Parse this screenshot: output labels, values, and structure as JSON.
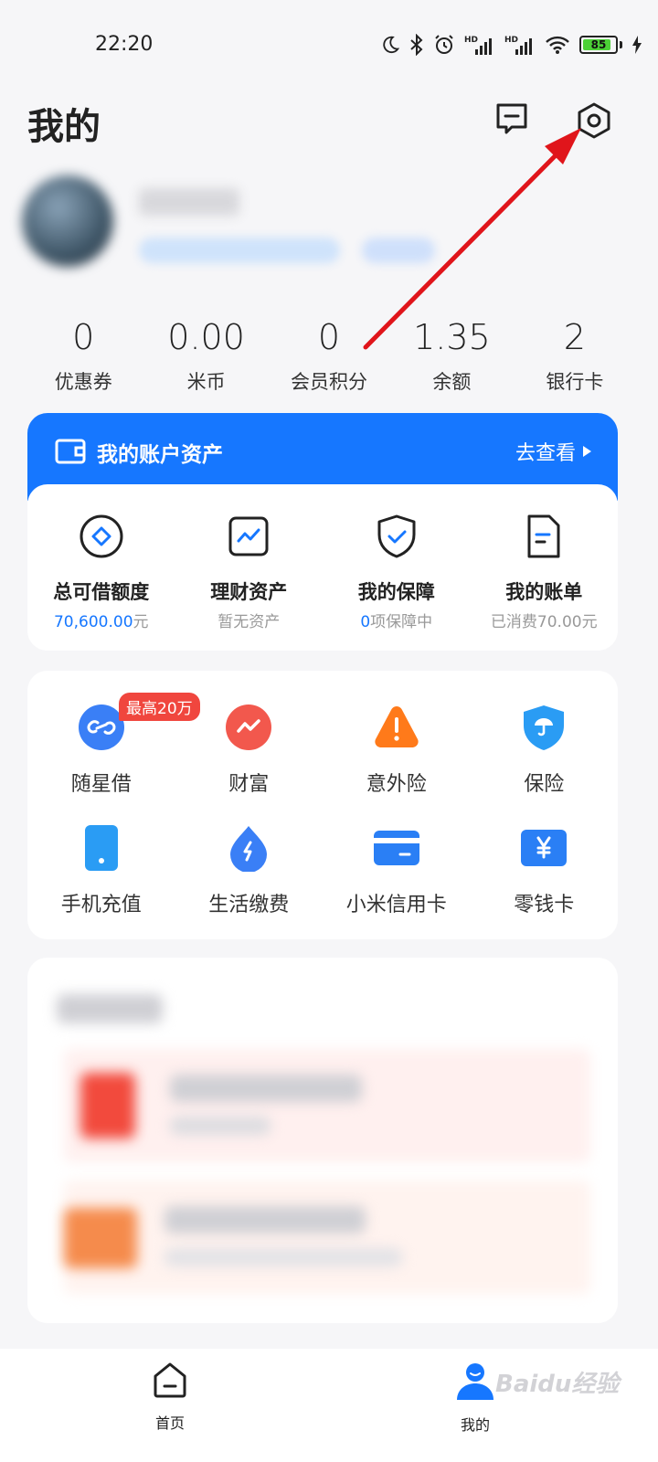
{
  "status_bar": {
    "time": "22:20",
    "battery": "85",
    "icons": [
      "moon-icon",
      "bluetooth-icon",
      "alarm-icon",
      "hd-signal-icon",
      "hd-signal-icon",
      "wifi-icon",
      "battery-icon",
      "charging-icon"
    ]
  },
  "header": {
    "title": "我的"
  },
  "stats": [
    {
      "value": "0",
      "label": "优惠券"
    },
    {
      "value": "0.00",
      "label": "米币"
    },
    {
      "value": "0",
      "label": "会员积分"
    },
    {
      "value": "1.35",
      "label": "余额"
    },
    {
      "value": "2",
      "label": "银行卡"
    }
  ],
  "assets": {
    "title": "我的账户资产",
    "link": "去查看",
    "items": [
      {
        "title": "总可借额度",
        "sub_value": "70,600.00",
        "sub_suffix": "元",
        "icon": "credit-diamond-icon"
      },
      {
        "title": "理财资产",
        "sub": "暂无资产",
        "icon": "wealth-chart-icon"
      },
      {
        "title": "我的保障",
        "sub_value": "0",
        "sub_suffix": "项保障中",
        "icon": "shield-check-icon"
      },
      {
        "title": "我的账单",
        "sub": "已消费70.00元",
        "icon": "bill-icon"
      }
    ]
  },
  "services": {
    "items": [
      {
        "label": "随星借",
        "badge": "最高20万",
        "icon": "link-loan-icon",
        "color": "#3a7ff6"
      },
      {
        "label": "财富",
        "icon": "wealth-trend-icon",
        "color": "#f2584d"
      },
      {
        "label": "意外险",
        "icon": "warning-icon",
        "color": "#ff7a1a"
      },
      {
        "label": "保险",
        "icon": "umbrella-shield-icon",
        "color": "#2a9cf4"
      },
      {
        "label": "手机充值",
        "icon": "phone-icon",
        "color": "#2a9cf4"
      },
      {
        "label": "生活缴费",
        "icon": "water-drop-icon",
        "color": "#3a7ff6"
      },
      {
        "label": "小米信用卡",
        "icon": "credit-card-icon",
        "color": "#2a7ff5"
      },
      {
        "label": "零钱卡",
        "icon": "yen-card-icon",
        "color": "#2a7ff5"
      }
    ]
  },
  "bottom_nav": {
    "home": "首页",
    "mine": "我的"
  },
  "watermark": "Baidu经验",
  "colors": {
    "accent": "#1677ff",
    "badge": "#f0463e",
    "arrow": "#e0151b"
  }
}
